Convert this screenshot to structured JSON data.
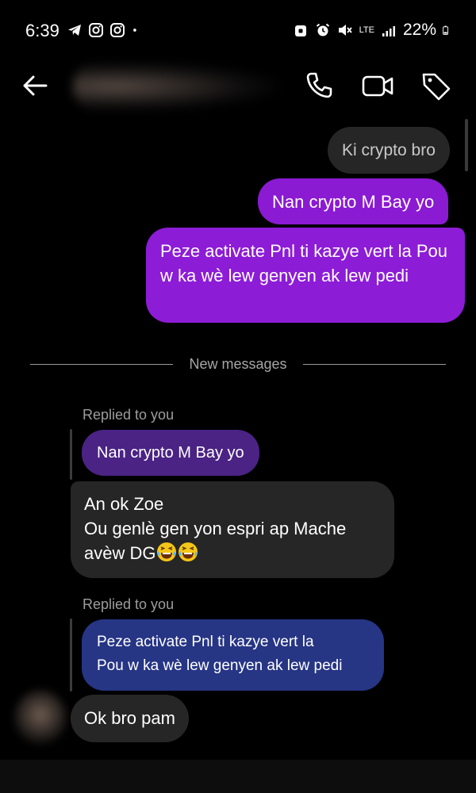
{
  "status_bar": {
    "time": "6:39",
    "network": "LTE",
    "battery": "22%",
    "icons": [
      "telegram-icon",
      "instagram-icon",
      "instagram-icon",
      "dot-icon",
      "lock-icon",
      "alarm-icon",
      "mute-icon",
      "signal-icon",
      "battery-icon"
    ]
  },
  "header": {
    "icons": [
      "back-arrow-icon",
      "phone-icon",
      "video-camera-icon",
      "tag-icon"
    ]
  },
  "messages": {
    "sent_grey": "Ki crypto bro",
    "sent_1": "Nan crypto M Bay yo",
    "sent_2": "Peze activate Pnl ti kazye vert la Pou w ka wè lew genyen ak lew pedi"
  },
  "divider": {
    "label": "New messages"
  },
  "received": {
    "reply_1": {
      "label": "Replied to you",
      "quoted": "Nan crypto M Bay yo",
      "lines": [
        "An ok Zoe",
        "Ou genlè gen yon espri ap Mache",
        "avèw DG"
      ]
    },
    "reply_2": {
      "label": "Replied to you",
      "quoted_lines": [
        "Peze activate Pnl ti kazye vert la",
        "Pou w ka wè lew genyen ak lew pedi"
      ]
    },
    "last": "Ok bro pam"
  },
  "colors": {
    "background": "#000000",
    "sent_bubble": "#8b1ad3",
    "received_bubble": "#262626",
    "quoted_purple": "#4a2384",
    "quoted_blue": "#263584"
  }
}
